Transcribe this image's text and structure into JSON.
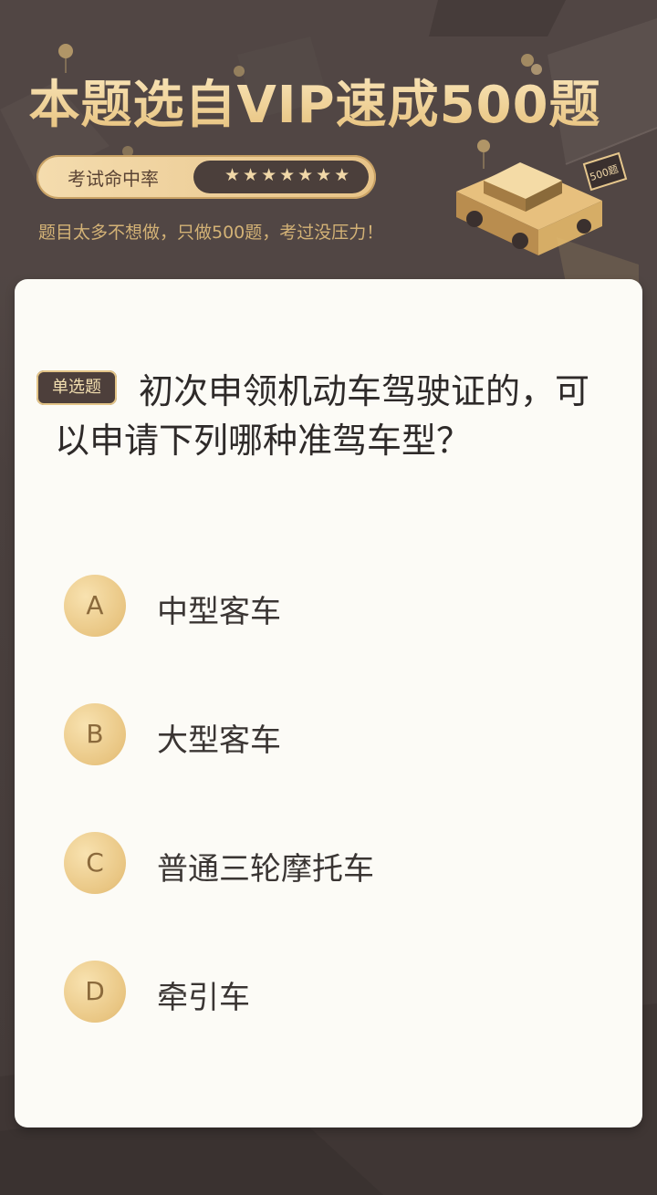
{
  "banner": {
    "title": "本题选自VIP速成500题",
    "rate_label": "考试命中率",
    "rate_stars": "★★★★★★★",
    "subtitle": "题目太多不想做，只做500题，考过没压力！",
    "car_sign": "500题"
  },
  "question": {
    "type_badge": "单选题",
    "text": "初次申领机动车驾驶证的，可以申请下列哪种准驾车型？",
    "options": [
      {
        "letter": "A",
        "text": "中型客车"
      },
      {
        "letter": "B",
        "text": "大型客车"
      },
      {
        "letter": "C",
        "text": "普通三轮摩托车"
      },
      {
        "letter": "D",
        "text": "牵引车"
      }
    ]
  },
  "colors": {
    "background": "#4d4341",
    "gold": "#e9c683",
    "card": "#fcfbf6"
  }
}
